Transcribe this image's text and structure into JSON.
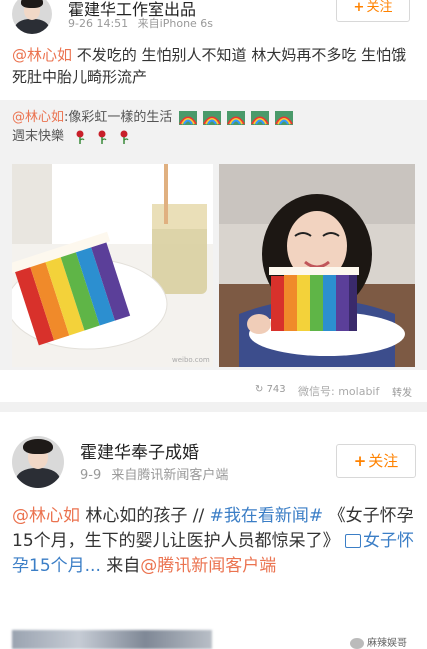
{
  "post1": {
    "author": "霍建华工作室出品",
    "time": "9-26 14:51",
    "source": "来自iPhone 6s",
    "follow_label": "关注",
    "mention": "@林心如",
    "text_rest": " 不发吃的 生怕别人不知道 林大妈再不多吃 生怕饿死肚中胎儿畸形流产",
    "repost": {
      "mention": "@林心如",
      "text": ":像彩虹一樣的生活",
      "line2": "週末快樂"
    },
    "photo_watermark": "weibo.com",
    "toolbar": {
      "repost_count": "743",
      "overlay": "微信号: molabif",
      "like_label": "转发"
    }
  },
  "post2": {
    "author": "霍建华奉子成婚",
    "time": "9-9",
    "source": "来自腾讯新闻客户端",
    "follow_label": "关注",
    "mention": "@林心如",
    "text_a": " 林心如的孩子 // ",
    "topic": "#我在看新闻#",
    "text_b": " 《女子怀孕15个月，生下的婴儿让医护人员都惊呆了》",
    "link_text": "女子怀孕15个月...",
    "text_c": " 来自",
    "mention2": "@腾讯新闻客户端"
  },
  "watermark": "麻辣娱哥",
  "colors": {
    "accent_orange": "#ff8200",
    "mention": "#eb7350",
    "topic": "#3b7ec6"
  }
}
